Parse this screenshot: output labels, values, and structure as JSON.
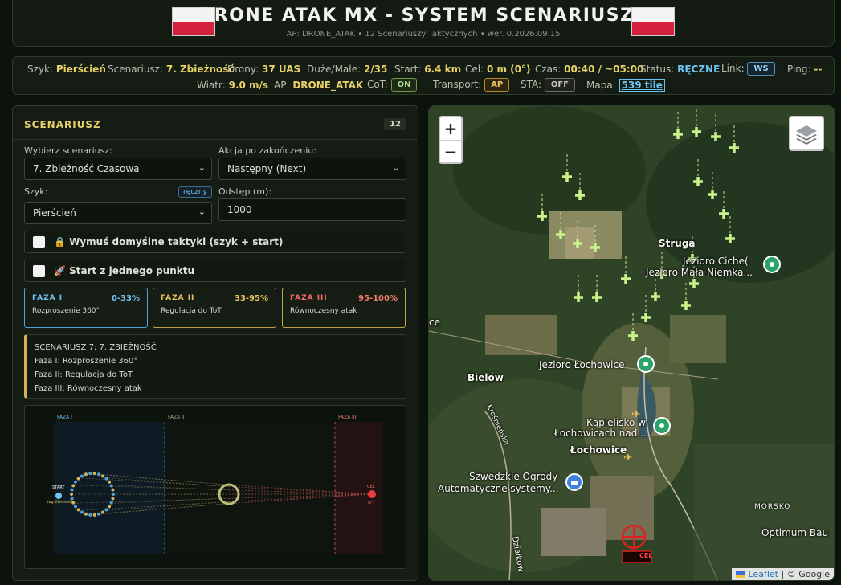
{
  "header": {
    "title": "DRONE ATAK MX - SYSTEM SCENARIUSZY",
    "subtitle": "AP: DRONE_ATAK • 12 Scenariuszy Taktycznych • wer. 0.2026.09.15"
  },
  "status": {
    "formation_label": "Szyk:",
    "formation_value": "Pierścień",
    "scenario_label": "Scenariusz:",
    "scenario_value": "7. Zbieżność",
    "drones_label": "Drony:",
    "drones_value": "37 UAS",
    "bigsmall_label": "Duże/Małe:",
    "bigsmall_value": "2/35",
    "start_label": "Start:",
    "start_value": "6.4 km",
    "target_label": "Cel:",
    "target_value": "0 m (0°)",
    "time_label": "Czas:",
    "time_value": "00:40 / ~05:00",
    "mode_label": "Status:",
    "mode_value": "RĘCZNE",
    "link_label": "Link:",
    "link_value": "WS",
    "ping_label": "Ping:",
    "ping_value": "--",
    "wind_label": "Wiatr:",
    "wind_value": "9.0 m/s",
    "ap_label": "AP:",
    "ap_value": "DRONE_ATAK",
    "cot_label": "CoT:",
    "cot_value": "ON",
    "transport_label": "Transport:",
    "transport_value": "AP",
    "sta_label": "STA:",
    "sta_value": "OFF",
    "map_label": "Mapa:",
    "map_value": "539 tile"
  },
  "panel": {
    "title": "SCENARIUSZ",
    "count": "12",
    "scenario_select_label": "Wybierz scenariusz:",
    "scenario_select_value": "7. Zbieżność Czasowa",
    "action_label": "Akcja po zakończeniu:",
    "action_value": "Następny (Next)",
    "formation_label": "Szyk:",
    "manual_badge": "ręczny",
    "formation_value": "Pierścień",
    "spacing_label": "Odstęp (m):",
    "spacing_value": "1000",
    "force_defaults": "🔒 Wymuś domyślne taktyki (szyk + start)",
    "single_start": "🚀 Start z jednego punktu",
    "phases": [
      {
        "name": "FAZA I",
        "range": "0-33%",
        "desc": "Rozproszenie 360°"
      },
      {
        "name": "FAZA II",
        "range": "33-95%",
        "desc": "Regulacja do ToT"
      },
      {
        "name": "FAZA III",
        "range": "95-100%",
        "desc": "Równoczesny atak"
      }
    ],
    "description_lines": [
      "SCENARIUSZ 7: 7. ZBIEŻNOŚĆ",
      "Faza I: Rozproszenie 360°",
      "Faza II: Regulacja do ToT",
      "Faza III: Równoczesny atak"
    ],
    "mini": {
      "phase1": "FAZA I",
      "phase2": "FAZA II",
      "phase3": "FAZA III",
      "start": "START",
      "start_sub": "(wg. Zbieżność)",
      "target": "CEL",
      "target_sub": "(0°)"
    }
  },
  "map": {
    "zoom_in": "+",
    "zoom_out": "−",
    "labels": {
      "struga": "Struga",
      "lake1": "Jezioro Ciche(",
      "lake2": "Jezioro Mała Niemka...",
      "lochowice_lake": "Jezioro Łochowice",
      "bielow": "Bielów",
      "kapielisko1": "Kąpielisko w",
      "kapielisko2": "Łochowicach nad...",
      "lochowice": "Łochowice",
      "ogrody1": "Szwedzkie Ogrody",
      "ogrody2": "Automatyczne systemy...",
      "krosnienska": "Krośnieńska",
      "morsko": "MORSKO",
      "optimum": "Optimum Bau",
      "dzialkowa": "Działkow",
      "ce": "ce",
      "target_marker": "CEL"
    },
    "attribution_leaflet": "Leaflet",
    "attribution_google": "| © Google"
  },
  "colors": {
    "accent": "#e8d069",
    "blue": "#6fc3f0",
    "drone": "#c9f28b",
    "target": "#e02020"
  }
}
